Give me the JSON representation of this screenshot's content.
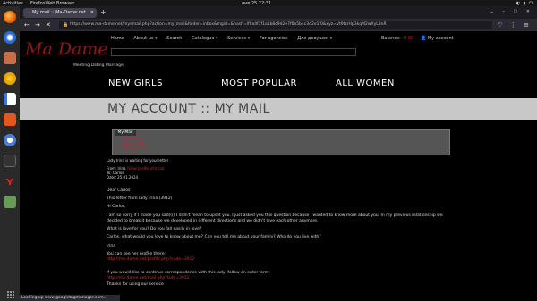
{
  "os": {
    "activities": "Activities",
    "app": "FirefoxWeb Browser",
    "clock": "янв 25  22:31"
  },
  "browser": {
    "tab_title": "My mail :: Ma-Dame.net",
    "url": "https://www.ma-dame.net/myemail.php?action=my_mail&folder=inbox&mgid=&hash=lf0a4f3f1a1b8c9d2e7f6a5b4c3d2e1f0&xyz=Vt9tzrHp3kqM2wXyL8nR",
    "status": "Looking up www.googletagmanager.com..."
  },
  "site": {
    "logo": "Ma Dame",
    "logo_sub": "Meeting Dating Marriage",
    "menu": [
      "Home",
      "About us ▾",
      "Search",
      "Catalogue ▾",
      "Services ▾",
      "For agencies",
      "Для девушек ▾"
    ],
    "balance_label": "Balance:",
    "balance_value": "-0.00",
    "my_account": "My account"
  },
  "categories": [
    "NEW GIRLS",
    "MOST POPULAR",
    "ALL WOMEN"
  ],
  "page_title": "MY ACCOUNT :: MY MAIL",
  "mailbox": {
    "tab": "My Mail",
    "items": [
      "Inbox (3)",
      "Outbox (0)",
      "Deleted (0)"
    ]
  },
  "letter": {
    "notice": "Lady Irina is waiting for your letter",
    "from_label": "From:",
    "from_name": "Irina",
    "profile_link": "(View profile of Irina)",
    "to": "To: Carlos",
    "date": "Date: 25.01.2024",
    "greeting": "Dear Carlos",
    "intro": "This letter from lady Irina (3912)",
    "hi": "Hi Carlos,",
    "body1": "I am so sorry if I made you sad(((( I didn't mean to upset you. I just asked you this question because I wanted to know more about you. In my previous relationship we decided to break it because we developed in different directions and we didn't love each other anymore.",
    "body2": "What is love for you? Do you fall easily in love?",
    "body3": "Carlos, what would you love to know about me? Can you tell me about your family? Who do you live with?",
    "sign": "Irina",
    "profile_line": "You can see her profile there:",
    "profile_url": "http://ma-dame.net/profile.php?code=3912",
    "continue_line": "If you would like to continue correspondence with this lady, follow on order form:",
    "continue_url": "http://ma-dame.net/mail.php?lady=3912",
    "thanks": "Thanks for using our service"
  },
  "colors": {
    "accent": "#cc2222",
    "logo": "#8b1a1a",
    "title_bar": "#c8c8c8"
  }
}
